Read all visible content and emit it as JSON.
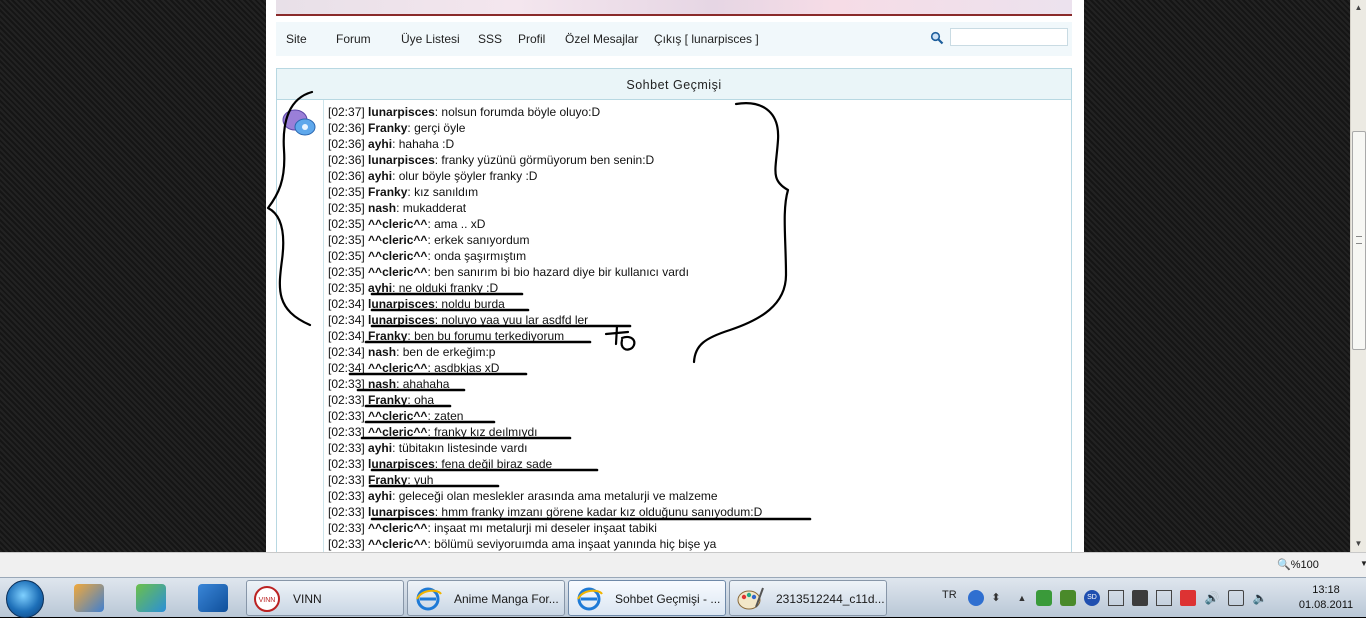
{
  "nav": {
    "items": [
      "Site",
      "Forum",
      "Üye Listesi",
      "SSS",
      "Profil",
      "Özel Mesajlar",
      "Çıkış [ lunarpisces ]"
    ],
    "search_placeholder": ""
  },
  "panel": {
    "title": "Sohbet Geçmişi"
  },
  "messages": [
    {
      "time": "[02:37]",
      "user": "lunarpisces",
      "text": ": nolsun forumda böyle oluyo:D"
    },
    {
      "time": "[02:36]",
      "user": "Franky",
      "text": ": gerçi öyle"
    },
    {
      "time": "[02:36]",
      "user": "ayhi",
      "text": ": hahaha :D"
    },
    {
      "time": "[02:36]",
      "user": "lunarpisces",
      "text": ": franky yüzünü görmüyorum ben senin:D"
    },
    {
      "time": "[02:36]",
      "user": "ayhi",
      "text": ": olur böyle şöyler franky :D"
    },
    {
      "time": "[02:35]",
      "user": "Franky",
      "text": ": kız sanıldım"
    },
    {
      "time": "[02:35]",
      "user": "nash",
      "text": ": mukadderat"
    },
    {
      "time": "[02:35]",
      "user": "^^cleric^^",
      "text": ": ama .. xD"
    },
    {
      "time": "[02:35]",
      "user": "^^cleric^^",
      "text": ": erkek sanıyordum"
    },
    {
      "time": "[02:35]",
      "user": "^^cleric^^",
      "text": ": onda şaşırmıştım"
    },
    {
      "time": "[02:35]",
      "user": "^^cleric^^",
      "text": ": ben sanırım bi bio hazard diye bir kullanıcı vardı"
    },
    {
      "time": "[02:35]",
      "user": "ayhi",
      "text": ": ne olduki franky :D"
    },
    {
      "time": "[02:34]",
      "user": "lunarpisces",
      "text": ": noldu burda"
    },
    {
      "time": "[02:34]",
      "user": "lunarpisces",
      "text": ": noluyo yaa yuu lar asdfd ler"
    },
    {
      "time": "[02:34]",
      "user": "Franky",
      "text": ": ben bu forumu terkediyorum"
    },
    {
      "time": "[02:34]",
      "user": "nash",
      "text": ": ben de erkeğim:p"
    },
    {
      "time": "[02:34]",
      "user": "^^cleric^^",
      "text": ": asdbkjas xD"
    },
    {
      "time": "[02:33]",
      "user": "nash",
      "text": ": ahahaha"
    },
    {
      "time": "[02:33]",
      "user": "Franky",
      "text": ": oha"
    },
    {
      "time": "[02:33]",
      "user": "^^cleric^^",
      "text": ": zaten"
    },
    {
      "time": "[02:33]",
      "user": "^^cleric^^",
      "text": ": franky kız deılmıydı"
    },
    {
      "time": "[02:33]",
      "user": "ayhi",
      "text": ": tübitakın listesinde vardı"
    },
    {
      "time": "[02:33]",
      "user": "lunarpisces",
      "text": ": fena değil biraz sade"
    },
    {
      "time": "[02:33]",
      "user": "Franky",
      "text": ": yuh"
    },
    {
      "time": "[02:33]",
      "user": "ayhi",
      "text": ": geleceği olan meslekler arasında ama metalurji ve malzeme"
    },
    {
      "time": "[02:33]",
      "user": "lunarpisces",
      "text": ": hmm franky imzanı görene kadar kız olduğunu sanıyodum:D"
    },
    {
      "time": "[02:33]",
      "user": "^^cleric^^",
      "text": ": inşaat mı metalurji mi deseler inşaat tabiki"
    },
    {
      "time": "[02:33]",
      "user": "^^cleric^^",
      "text": ": bölümü seviyoruımda ama inşaat yanında hiç bişe ya"
    }
  ],
  "statusbar": {
    "zoom": "%100"
  },
  "taskbar": {
    "tasks": [
      {
        "label": "VINN",
        "icon": "vinn-icon"
      },
      {
        "label": "Anime Manga For...",
        "icon": "ie-icon"
      },
      {
        "label": "Sohbet Geçmişi - ...",
        "icon": "ie-icon"
      },
      {
        "label": "2313512244_c11d...",
        "icon": "paint-icon"
      }
    ],
    "lang": "TR",
    "time": "13:18",
    "date": "01.08.2011"
  },
  "colors": {
    "accent_panel": "#eaf5f8",
    "panel_border": "#b8d8e2",
    "taskbar": "#c9d6e4"
  }
}
